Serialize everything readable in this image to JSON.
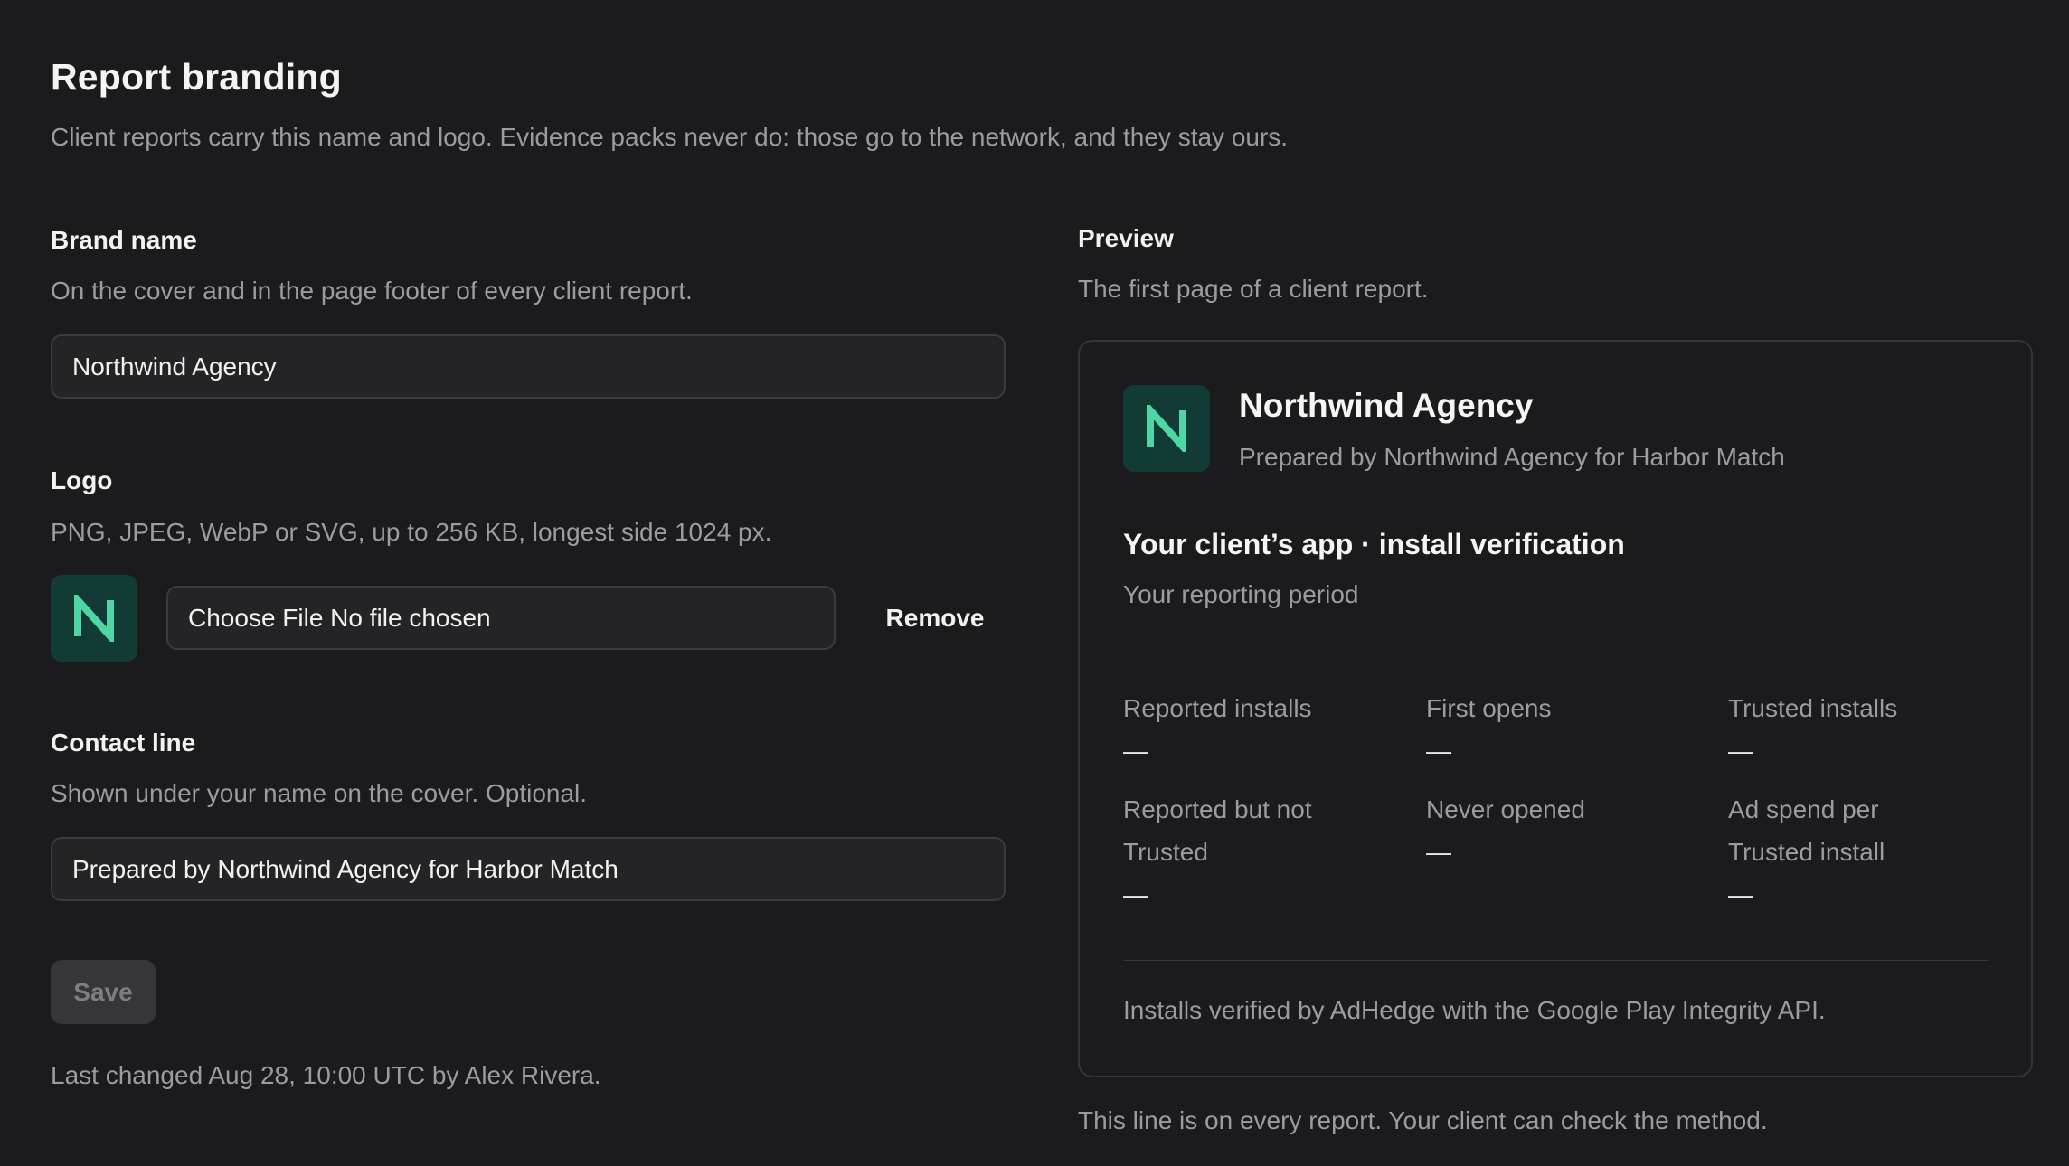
{
  "header": {
    "title": "Report branding",
    "subtitle": "Client reports carry this name and logo. Evidence packs never do: those go to the network, and they stay ours."
  },
  "brand_name": {
    "label": "Brand name",
    "help": "On the cover and in the page footer of every client report.",
    "value": "Northwind Agency"
  },
  "logo": {
    "label": "Logo",
    "help": "PNG, JPEG, WebP or SVG, up to 256 KB, longest side 1024 px.",
    "letter": "N",
    "file_input_text": "Choose File No file chosen",
    "remove_label": "Remove"
  },
  "contact_line": {
    "label": "Contact line",
    "help": "Shown under your name on the cover. Optional.",
    "value": "Prepared by Northwind Agency for Harbor Match"
  },
  "actions": {
    "save_label": "Save",
    "last_changed": "Last changed Aug 28, 10:00 UTC by Alex Rivera."
  },
  "preview": {
    "label": "Preview",
    "help": "The first page of a client report.",
    "brand": "Northwind Agency",
    "contact": "Prepared by Northwind Agency for Harbor Match",
    "heading": "Your client’s app · install verification",
    "period": "Your reporting period",
    "metrics": [
      {
        "label": "Reported installs",
        "value": "—"
      },
      {
        "label": "First opens",
        "value": "—"
      },
      {
        "label": "Trusted installs",
        "value": "—"
      },
      {
        "label": "Reported but not Trusted",
        "value": "—"
      },
      {
        "label": "Never opened",
        "value": "—"
      },
      {
        "label": "Ad spend per Trusted install",
        "value": "—"
      }
    ],
    "footer": "Installs verified by AdHedge with the Google Play Integrity API.",
    "note": "This line is on every report. Your client can check the method."
  },
  "colors": {
    "background": "#1b1b1e",
    "logo_tile": "#123b36",
    "logo_letter": "#4fd6a5"
  }
}
